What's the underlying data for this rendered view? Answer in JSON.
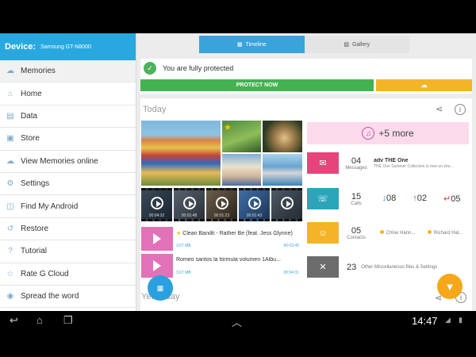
{
  "sidebar": {
    "device_label": "Device:",
    "device_value": "Samsung GT-N8000",
    "items": [
      {
        "label": "Memories",
        "icon": "cloud-icon"
      },
      {
        "label": "Home",
        "icon": "home-icon"
      },
      {
        "label": "Data",
        "icon": "data-icon"
      },
      {
        "label": "Store",
        "icon": "store-icon"
      },
      {
        "label": "View Memories online",
        "icon": "cloud-icon"
      },
      {
        "label": "Settings",
        "icon": "settings-icon"
      },
      {
        "label": "Find My Android",
        "icon": "map-icon"
      },
      {
        "label": "Restore",
        "icon": "restore-icon"
      },
      {
        "label": "Tutorial",
        "icon": "help-icon"
      },
      {
        "label": "Rate G Cloud",
        "icon": "star-icon"
      },
      {
        "label": "Spread the word",
        "icon": "megaphone-icon"
      }
    ]
  },
  "tabs": [
    {
      "label": "Timeline",
      "active": true
    },
    {
      "label": "Gallery",
      "active": false
    }
  ],
  "protection": {
    "message": "You are fully protected",
    "button": "PROTECT NOW"
  },
  "today": {
    "title": "Today",
    "videos": [
      "00:04:32",
      "00:01:48",
      "00:01:23",
      "00:01:43",
      ""
    ],
    "music": [
      {
        "title": "Clean Bandit - Rather Be (feat. Jess Glynne)",
        "size": "3.67 MB",
        "duration": "00:03:45",
        "starred": true
      },
      {
        "title": "Romeo santos la fórmula volumen 1Albu...",
        "size": "3.67 MB",
        "duration": "00:04:31",
        "starred": false
      }
    ],
    "more": "+5 more",
    "messages": {
      "count": "04",
      "label": "Messages",
      "sender": "adv THE One",
      "preview": "THE One Summer Collection is now on sho..."
    },
    "calls": {
      "count": "15",
      "label": "Calls",
      "incoming": "08",
      "outgoing": "02",
      "missed": "05"
    },
    "contacts": {
      "count": "05",
      "label": "Contacts",
      "names": [
        "Chloe Hann...",
        "Richard Hal..."
      ]
    },
    "misc": {
      "count": "23",
      "label": "Other Miscellaneous files & Settings"
    }
  },
  "yesterday": {
    "title": "Yesterday"
  },
  "status": {
    "time": "14:47"
  },
  "colors": {
    "primary": "#29a8e0",
    "green": "#43b352",
    "orange": "#f5b428",
    "pink": "#e172b7",
    "teal": "#2ba6b8"
  }
}
